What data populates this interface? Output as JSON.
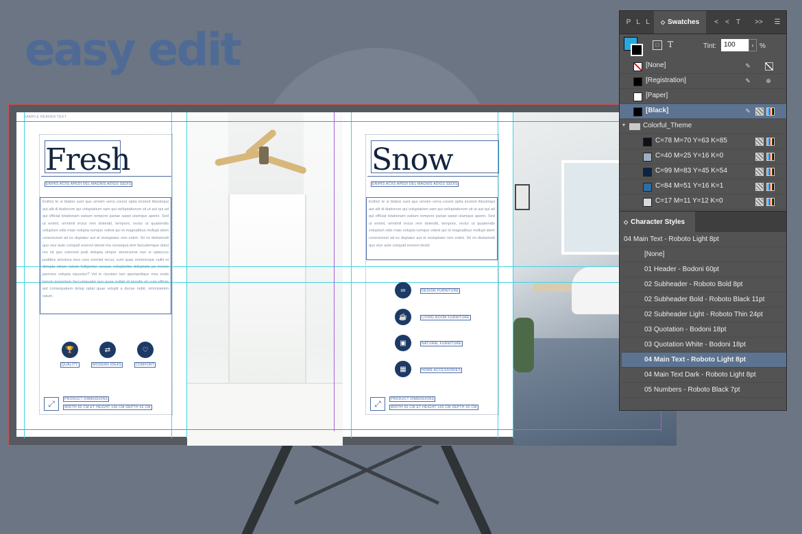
{
  "hero": {
    "title": "easy edit"
  },
  "colors": {
    "accent": "#4f6b95",
    "panel": "#535353",
    "selection": "#5c7391",
    "guide": "#3fd3df",
    "margin": "#d54fd5",
    "ink": "#12233e"
  },
  "spread": {
    "left_page": {
      "title": "Fresh",
      "header_label": "SAMPLE HEADER TEXT",
      "subheading": "ENIHIS ACIIS APEDI DEL MAGNIS ADIGS SEDIS",
      "body": "Enihici te si blabor sunt quo omnim verra corest optia inciend itiissimqui aut alit di blaborum qui voluptatium sam qui velluptatiorum sit ut aut qui ad qui officiat totationam eatium rempore pariae saept utamque aperio. Sed ut enimil, omnimil inctur rem dolendit, tempore, rectur ut quatemdis voluptum odis maio volupta rumque volest qui et magnatibus mollupt atem conecturest ad ex duptatur aut et moluptatur rem estint. Sit mi disitamodi quo etur aute conquid exerovi dexist ma consequa tem faccatemque dolut res sit quo voloresti pudi dolupta simpor simniciume nue si optaccus puditios simolora mos core ommiel recus; sunt quas molorerspic nullit et dolupta eiliam ratium fulligentur accaut, volupturibs doluptatis pa inveris pariores volupta squuntur? Vel in ctuntam ium aperspelique mos enda harum ipsendam faccumquatet quo quae sollab id eiusdis sit cum officiis aut consequatem dolup optat quae volupit a ducae nobit, ommisienim ratum.",
      "features": [
        {
          "icon": "trophy-icon",
          "label": "QUALITY"
        },
        {
          "icon": "shuffle-icon",
          "label": "MODERN IDEAS"
        },
        {
          "icon": "heart-icon",
          "label": "COMFORT"
        }
      ],
      "footer": {
        "title": "PRODUCT DIMENSIONS",
        "text": "WIDTH 50 CM ET HEIGHT 100 CM DEPTH 50 CM"
      }
    },
    "right_page": {
      "title": "Snow",
      "subheading": "ENIHIS ACIIS APEDI DEL MAGNIS ADIGS SEDIS",
      "body": "Enihici te si blabor sunt quo omnim verra corest optia inciend itiissimqui aut alit di blaborum qui voluptatium sam qui velluptatiorum sit ut aut qui ad qui officiat totationam eatium rempore pariae saept utamque aperio. Sed ut enimil, omnimil inctur rem dolendit, tempore, rectur ut quatemdis voluptum odis maio volupta rumque volest qui et magnatibus mollupt atem conecturest ad ex duptatur aut et moluptatur rem estint. Sit mi disitamodi quo etur aute conquid exerovi desid",
      "features": [
        {
          "icon": "infinity-icon",
          "label": "DESIGN FURNITURE"
        },
        {
          "icon": "mug-icon",
          "label": "LIVING ROOM FURNITURE"
        },
        {
          "icon": "image-icon",
          "label": "NATURAL FURNITURE"
        },
        {
          "icon": "grid-icon",
          "label": "HOME ACCESSORIES"
        }
      ],
      "footer": {
        "title": "PRODUCT DIMENSIONS",
        "text": "WIDTH 50 CM ET HEIGHT 100 CM DEPTH 50 CM"
      }
    }
  },
  "panel": {
    "tabs": [
      "P",
      "L",
      "L",
      "Swatches",
      "<",
      "<",
      "T",
      ">>"
    ],
    "active_tab": "Swatches",
    "tint_label": "Tint:",
    "tint_value": "100",
    "tint_unit": "%",
    "swatches": [
      {
        "name": "[None]",
        "chip": "none"
      },
      {
        "name": "[Registration]",
        "chip": "#000000"
      },
      {
        "name": "[Paper]",
        "chip": "#ffffff"
      },
      {
        "name": "[Black]",
        "chip": "#000000",
        "selected": true
      }
    ],
    "group": {
      "name": "Colorful_Theme",
      "swatches": [
        {
          "name": "C=78 M=70 Y=63 K=85",
          "chip": "#0f1117"
        },
        {
          "name": "C=40 M=25 Y=16 K=0",
          "chip": "#9eafc2"
        },
        {
          "name": "C=99 M=83 Y=45 K=54",
          "chip": "#0b2346"
        },
        {
          "name": "C=84 M=51 Y=16 K=1",
          "chip": "#2e6da4"
        },
        {
          "name": "C=17 M=11 Y=12 K=0",
          "chip": "#d4dade"
        }
      ]
    },
    "char_styles_title": "Character Styles",
    "current_style": "04 Main Text - Roboto Light 8pt",
    "char_styles": [
      {
        "name": "[None]"
      },
      {
        "name": "01 Header - Bodoni 60pt"
      },
      {
        "name": "02 Subheader - Roboto Bold 8pt"
      },
      {
        "name": "02 Subheader Bold - Roboto Black 11pt"
      },
      {
        "name": "02 Subheader Light - Roboto Thin 24pt"
      },
      {
        "name": "03 Quotation - Bodoni 18pt"
      },
      {
        "name": "03 Quotation White - Bodoni 18pt"
      },
      {
        "name": "04 Main Text - Roboto Light 8pt",
        "selected": true
      },
      {
        "name": "04 Main Text Dark - Roboto Light 8pt"
      },
      {
        "name": "05 Numbers - Roboto Black 7pt"
      }
    ]
  }
}
